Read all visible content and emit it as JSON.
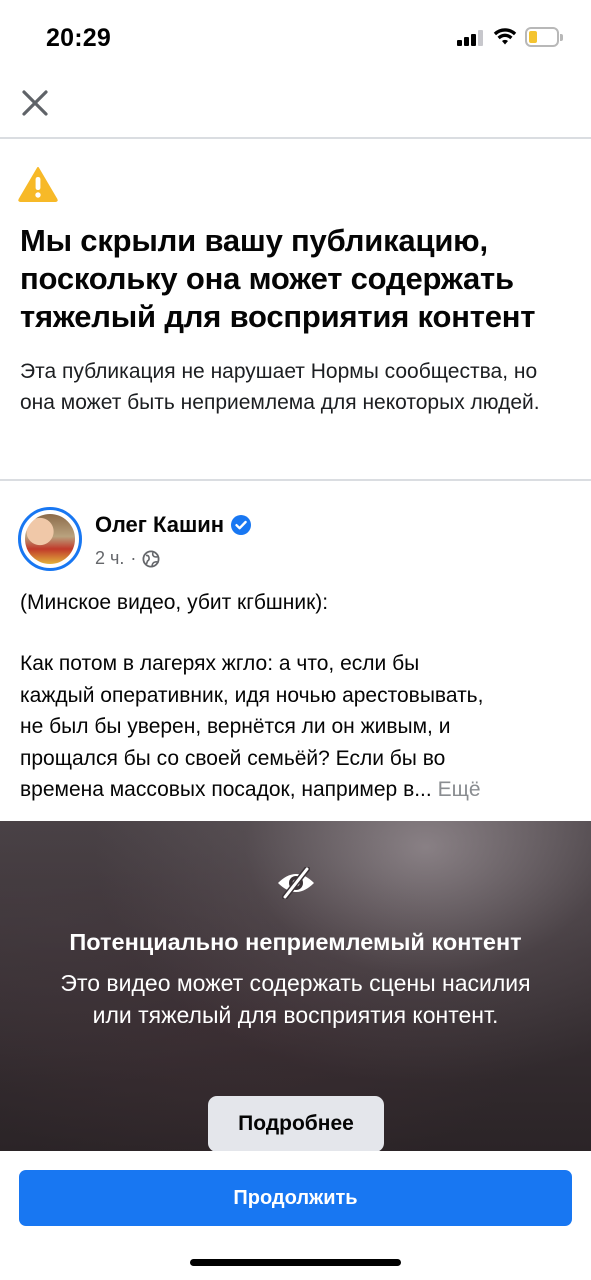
{
  "status_bar": {
    "time": "20:29"
  },
  "icons": {
    "close": "close-icon",
    "warning": "warning-icon",
    "verified": "verified-badge-icon",
    "globe": "globe-icon",
    "eye_off": "eye-off-icon"
  },
  "colors": {
    "accent": "#1877f2",
    "warning": "#f7b928",
    "muted_text": "#65676b",
    "secondary_button": "#e4e6eb"
  },
  "notice": {
    "headline": "Мы скрыли вашу публикацию, поскольку она может содержать тяжелый для восприятия контент",
    "description": "Эта публикация не нарушает Нормы сообщества, но она может быть неприемлема для некоторых людей."
  },
  "post": {
    "author": "Олег Кашин",
    "time": "2 ч.",
    "separator": "·",
    "lines": [
      "(Минское видео, убит кгбшник):",
      "Как потом в лагерях жгло: а что, если бы",
      "каждый оперативник, идя ночью арестовывать,",
      "не был бы уверен, вернётся ли он живым, и",
      "прощался бы со своей семьёй? Если бы во",
      "времена массовых посадок, например в..."
    ],
    "more": "Ещё"
  },
  "video": {
    "title": "Потенциально неприемлемый контент",
    "description": "Это видео может содержать сцены насилия или тяжелый для восприятия контент.",
    "details_button": "Подробнее"
  },
  "footer": {
    "continue_button": "Продолжить"
  }
}
